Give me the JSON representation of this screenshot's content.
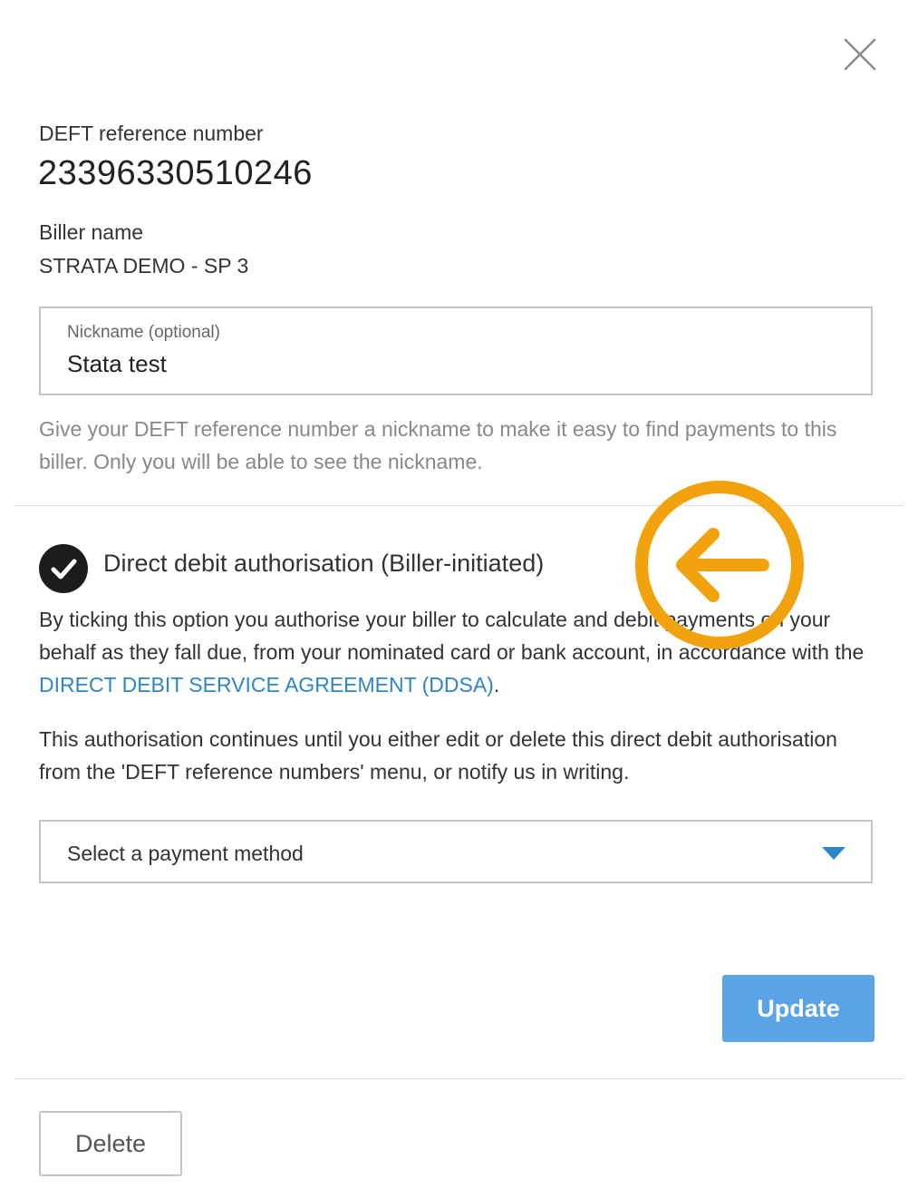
{
  "dialog": {
    "close_icon": "close-icon",
    "reference": {
      "label": "DEFT reference number",
      "value": "23396330510246"
    },
    "biller": {
      "label": "Biller name",
      "value": "STRATA DEMO - SP 3"
    },
    "nickname": {
      "label": "Nickname (optional)",
      "value": "Stata test",
      "hint": "Give your DEFT reference number a nickname to make it easy to find payments to this biller. Only you will be able to see the nickname."
    },
    "direct_debit": {
      "checked": true,
      "check_icon": "check-circle-icon",
      "title": "Direct debit authorisation (Biller-initiated)",
      "paragraph1_text": "By ticking this option you authorise your biller to calculate and debit payments on your behalf as they fall due, from your nominated card or bank account, in accordance with the ",
      "ddsa_link": "DIRECT DEBIT SERVICE AGREEMENT (DDSA)",
      "paragraph1_end": ".",
      "paragraph2": "This authorisation continues until you either edit or delete this direct debit authorisation from the 'DEFT reference numbers' menu, or notify us in writing."
    },
    "payment_method": {
      "selected": "Select a payment method",
      "caret_icon": "caret-down-icon"
    },
    "update_label": "Update",
    "delete_label": "Delete"
  },
  "annotation": {
    "icon": "arrow-left-icon",
    "color": "#f2a20c"
  },
  "colors": {
    "link": "#2e86c8",
    "primary_button": "#5aa3e6",
    "hint_text": "#888888"
  }
}
